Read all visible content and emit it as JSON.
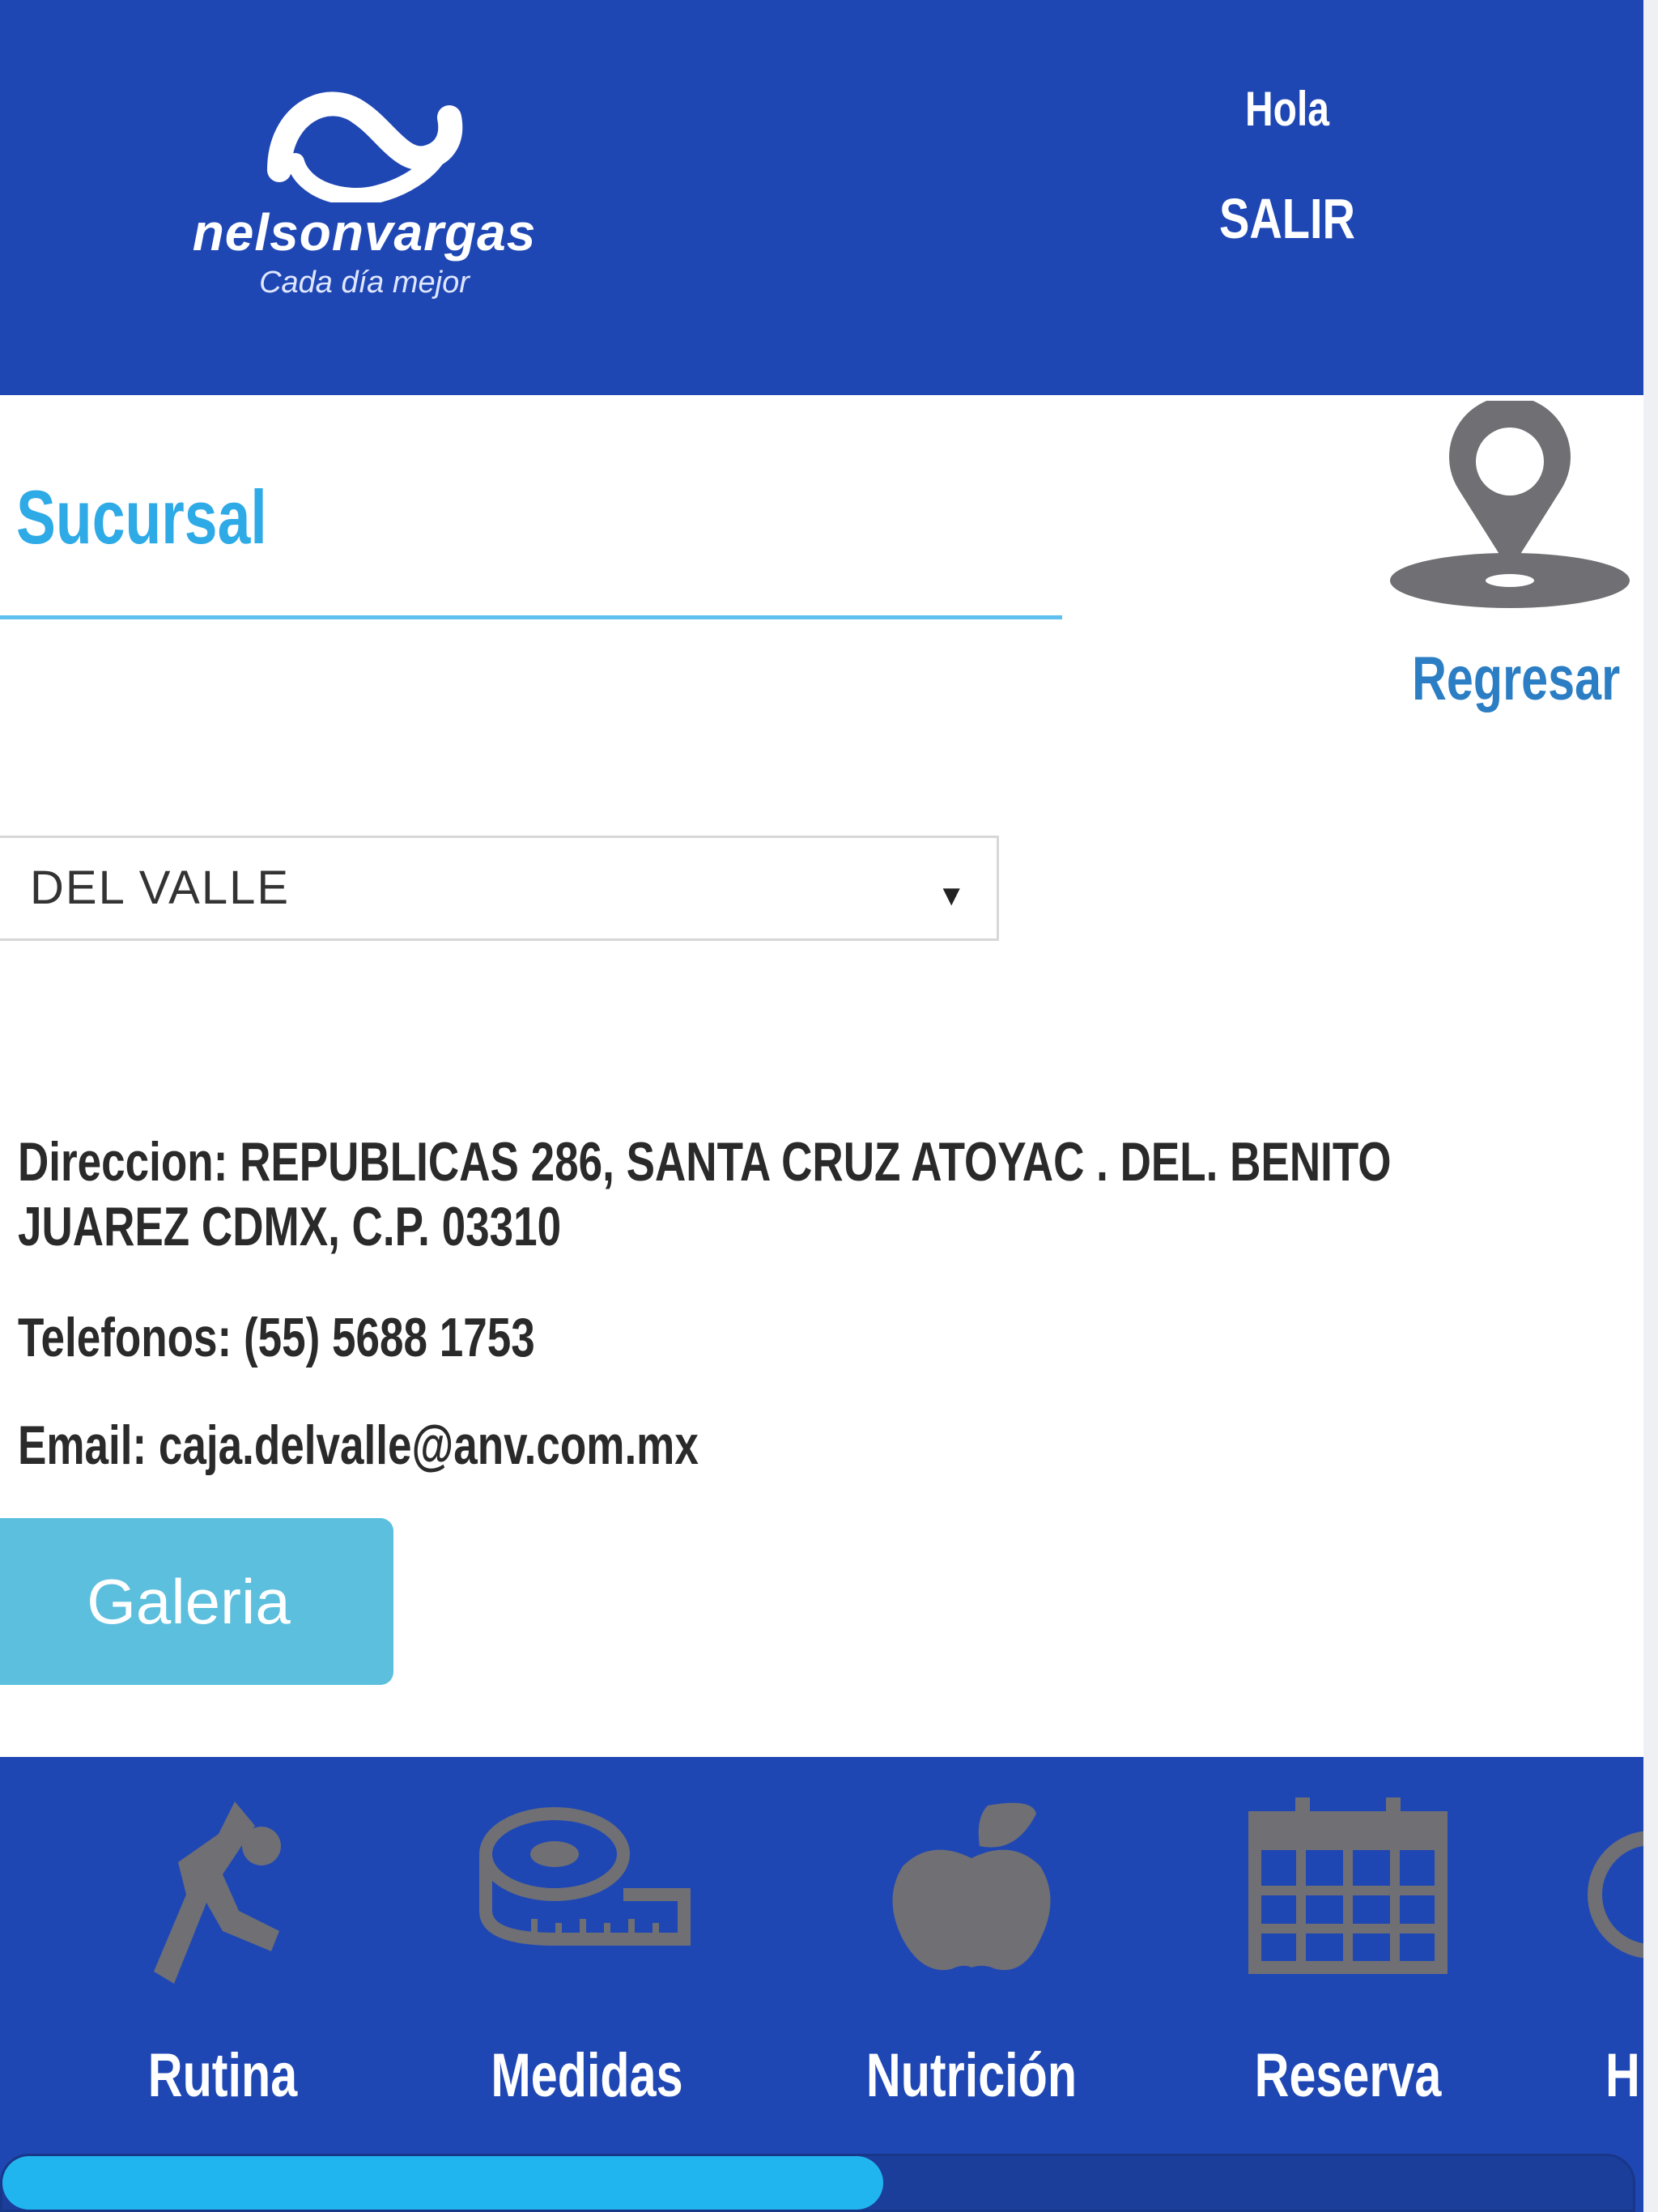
{
  "header": {
    "brand_name": "nelsonvargas",
    "brand_tagline": "Cada día mejor",
    "greeting": "Hola",
    "logout_label": "SALIR"
  },
  "page": {
    "title": "Sucursal",
    "back_label": "Regresar"
  },
  "branch": {
    "selected": "DEL VALLE",
    "address": "Direccion: REPUBLICAS 286, SANTA CRUZ ATOYAC . DEL. BENITO",
    "address_line2": "JUAREZ CDMX, C.P. 03310",
    "phone": "Telefonos: (55) 5688 1753",
    "email": "Email: caja.delvalle@anv.com.mx"
  },
  "gallery_label": "Galeria",
  "bottom_nav": {
    "items": [
      {
        "label": "Rutina",
        "icon": "exercise-icon"
      },
      {
        "label": "Medidas",
        "icon": "tape-measure-icon"
      },
      {
        "label": "Nutrición",
        "icon": "apple-icon"
      },
      {
        "label": "Reserva",
        "icon": "calendar-icon"
      },
      {
        "label": "H",
        "icon": "partial-icon"
      }
    ],
    "scroll_progress": 0.54
  },
  "colors": {
    "primary": "#1f47b4",
    "accent": "#2eaae6",
    "icon_gray": "#6f6f74",
    "button": "#5bbfdd",
    "progress": "#21b5ef"
  }
}
